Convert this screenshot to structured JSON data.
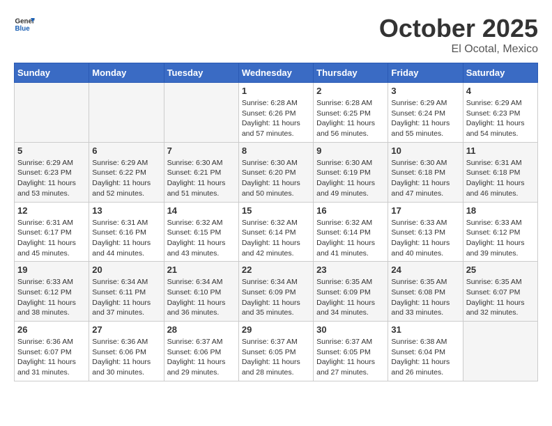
{
  "header": {
    "logo_general": "General",
    "logo_blue": "Blue",
    "month": "October 2025",
    "location": "El Ocotal, Mexico"
  },
  "days_of_week": [
    "Sunday",
    "Monday",
    "Tuesday",
    "Wednesday",
    "Thursday",
    "Friday",
    "Saturday"
  ],
  "weeks": [
    [
      {
        "day": "",
        "empty": true
      },
      {
        "day": "",
        "empty": true
      },
      {
        "day": "",
        "empty": true
      },
      {
        "day": "1",
        "sunrise": "6:28 AM",
        "sunset": "6:26 PM",
        "daylight": "11 hours and 57 minutes."
      },
      {
        "day": "2",
        "sunrise": "6:28 AM",
        "sunset": "6:25 PM",
        "daylight": "11 hours and 56 minutes."
      },
      {
        "day": "3",
        "sunrise": "6:29 AM",
        "sunset": "6:24 PM",
        "daylight": "11 hours and 55 minutes."
      },
      {
        "day": "4",
        "sunrise": "6:29 AM",
        "sunset": "6:23 PM",
        "daylight": "11 hours and 54 minutes."
      }
    ],
    [
      {
        "day": "5",
        "sunrise": "6:29 AM",
        "sunset": "6:23 PM",
        "daylight": "11 hours and 53 minutes."
      },
      {
        "day": "6",
        "sunrise": "6:29 AM",
        "sunset": "6:22 PM",
        "daylight": "11 hours and 52 minutes."
      },
      {
        "day": "7",
        "sunrise": "6:30 AM",
        "sunset": "6:21 PM",
        "daylight": "11 hours and 51 minutes."
      },
      {
        "day": "8",
        "sunrise": "6:30 AM",
        "sunset": "6:20 PM",
        "daylight": "11 hours and 50 minutes."
      },
      {
        "day": "9",
        "sunrise": "6:30 AM",
        "sunset": "6:19 PM",
        "daylight": "11 hours and 49 minutes."
      },
      {
        "day": "10",
        "sunrise": "6:30 AM",
        "sunset": "6:18 PM",
        "daylight": "11 hours and 47 minutes."
      },
      {
        "day": "11",
        "sunrise": "6:31 AM",
        "sunset": "6:18 PM",
        "daylight": "11 hours and 46 minutes."
      }
    ],
    [
      {
        "day": "12",
        "sunrise": "6:31 AM",
        "sunset": "6:17 PM",
        "daylight": "11 hours and 45 minutes."
      },
      {
        "day": "13",
        "sunrise": "6:31 AM",
        "sunset": "6:16 PM",
        "daylight": "11 hours and 44 minutes."
      },
      {
        "day": "14",
        "sunrise": "6:32 AM",
        "sunset": "6:15 PM",
        "daylight": "11 hours and 43 minutes."
      },
      {
        "day": "15",
        "sunrise": "6:32 AM",
        "sunset": "6:14 PM",
        "daylight": "11 hours and 42 minutes."
      },
      {
        "day": "16",
        "sunrise": "6:32 AM",
        "sunset": "6:14 PM",
        "daylight": "11 hours and 41 minutes."
      },
      {
        "day": "17",
        "sunrise": "6:33 AM",
        "sunset": "6:13 PM",
        "daylight": "11 hours and 40 minutes."
      },
      {
        "day": "18",
        "sunrise": "6:33 AM",
        "sunset": "6:12 PM",
        "daylight": "11 hours and 39 minutes."
      }
    ],
    [
      {
        "day": "19",
        "sunrise": "6:33 AM",
        "sunset": "6:12 PM",
        "daylight": "11 hours and 38 minutes."
      },
      {
        "day": "20",
        "sunrise": "6:34 AM",
        "sunset": "6:11 PM",
        "daylight": "11 hours and 37 minutes."
      },
      {
        "day": "21",
        "sunrise": "6:34 AM",
        "sunset": "6:10 PM",
        "daylight": "11 hours and 36 minutes."
      },
      {
        "day": "22",
        "sunrise": "6:34 AM",
        "sunset": "6:09 PM",
        "daylight": "11 hours and 35 minutes."
      },
      {
        "day": "23",
        "sunrise": "6:35 AM",
        "sunset": "6:09 PM",
        "daylight": "11 hours and 34 minutes."
      },
      {
        "day": "24",
        "sunrise": "6:35 AM",
        "sunset": "6:08 PM",
        "daylight": "11 hours and 33 minutes."
      },
      {
        "day": "25",
        "sunrise": "6:35 AM",
        "sunset": "6:07 PM",
        "daylight": "11 hours and 32 minutes."
      }
    ],
    [
      {
        "day": "26",
        "sunrise": "6:36 AM",
        "sunset": "6:07 PM",
        "daylight": "11 hours and 31 minutes."
      },
      {
        "day": "27",
        "sunrise": "6:36 AM",
        "sunset": "6:06 PM",
        "daylight": "11 hours and 30 minutes."
      },
      {
        "day": "28",
        "sunrise": "6:37 AM",
        "sunset": "6:06 PM",
        "daylight": "11 hours and 29 minutes."
      },
      {
        "day": "29",
        "sunrise": "6:37 AM",
        "sunset": "6:05 PM",
        "daylight": "11 hours and 28 minutes."
      },
      {
        "day": "30",
        "sunrise": "6:37 AM",
        "sunset": "6:05 PM",
        "daylight": "11 hours and 27 minutes."
      },
      {
        "day": "31",
        "sunrise": "6:38 AM",
        "sunset": "6:04 PM",
        "daylight": "11 hours and 26 minutes."
      },
      {
        "day": "",
        "empty": true
      }
    ]
  ]
}
